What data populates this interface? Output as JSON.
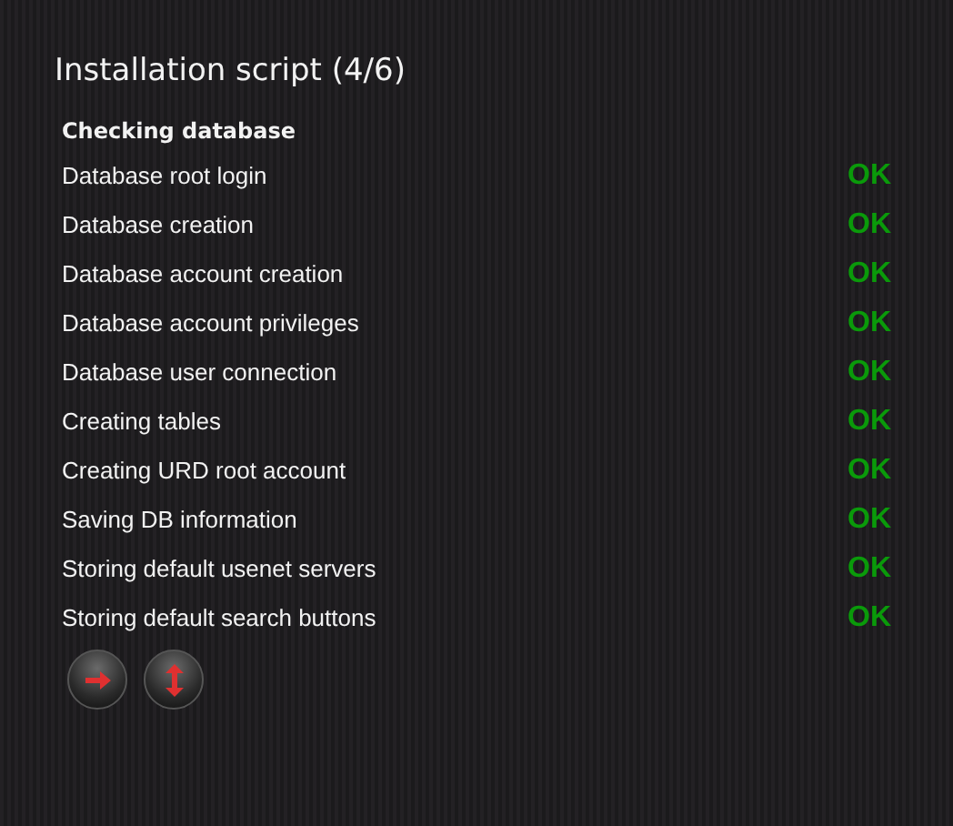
{
  "title": "Installation script (4/6)",
  "section": "Checking database",
  "steps": [
    {
      "label": "Database root login",
      "status": "OK"
    },
    {
      "label": "Database creation",
      "status": "OK"
    },
    {
      "label": "Database account creation",
      "status": "OK"
    },
    {
      "label": "Database account privileges",
      "status": "OK"
    },
    {
      "label": "Database user connection",
      "status": "OK"
    },
    {
      "label": "Creating tables",
      "status": "OK"
    },
    {
      "label": "Creating URD root account",
      "status": "OK"
    },
    {
      "label": "Saving DB information",
      "status": "OK"
    },
    {
      "label": "Storing default usenet servers",
      "status": "OK"
    },
    {
      "label": "Storing default search buttons",
      "status": "OK"
    }
  ],
  "buttons": [
    {
      "kind": "next"
    },
    {
      "kind": "toggle"
    }
  ]
}
